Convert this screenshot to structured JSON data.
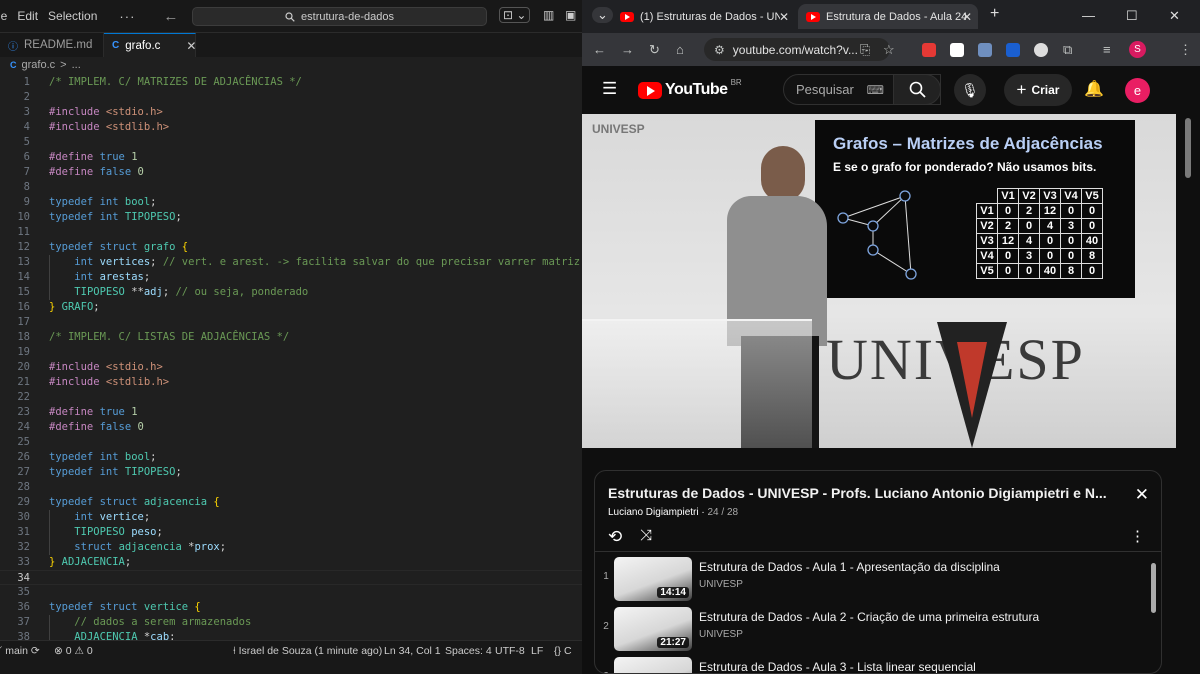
{
  "vscode": {
    "menu": [
      "le",
      "Edit",
      "Selection",
      "···"
    ],
    "search": "estrutura-de-dados",
    "tabs": [
      {
        "label": "README.md",
        "icon": "info-icon",
        "active": false
      },
      {
        "label": "grafo.c",
        "icon": "c-file-icon",
        "active": true
      }
    ],
    "breadcrumb": [
      "grafo.c",
      ">",
      "..."
    ],
    "lines": [
      [
        [
          "c-com",
          "/* IMPLEM. C/ MATRIZES DE ADJACÊNCIAS */"
        ]
      ],
      [],
      [
        [
          "c-pp",
          "#include "
        ],
        [
          "c-inc",
          "<stdio.h>"
        ]
      ],
      [
        [
          "c-pp",
          "#include "
        ],
        [
          "c-inc",
          "<stdlib.h>"
        ]
      ],
      [],
      [
        [
          "c-pp",
          "#define "
        ],
        [
          "c-kw",
          "true "
        ],
        [
          "c-num",
          "1"
        ]
      ],
      [
        [
          "c-pp",
          "#define "
        ],
        [
          "c-kw",
          "false "
        ],
        [
          "c-num",
          "0"
        ]
      ],
      [],
      [
        [
          "c-kw",
          "typedef "
        ],
        [
          "c-kw",
          "int "
        ],
        [
          "c-ty",
          "bool"
        ],
        [
          "c-txt",
          ";"
        ]
      ],
      [
        [
          "c-kw",
          "typedef "
        ],
        [
          "c-kw",
          "int "
        ],
        [
          "c-ty",
          "TIPOPESO"
        ],
        [
          "c-txt",
          ";"
        ]
      ],
      [],
      [
        [
          "c-kw",
          "typedef "
        ],
        [
          "c-kw",
          "struct "
        ],
        [
          "c-ty",
          "grafo "
        ],
        [
          "c-br",
          "{"
        ]
      ],
      [
        [
          "c-txt",
          "    "
        ],
        [
          "c-kw",
          "int "
        ],
        [
          "c-id",
          "vertices"
        ],
        [
          "c-txt",
          "; "
        ],
        [
          "c-com",
          "// vert. e arest. -> facilita salvar do que precisar varrer matriz sempre"
        ]
      ],
      [
        [
          "c-txt",
          "    "
        ],
        [
          "c-kw",
          "int "
        ],
        [
          "c-id",
          "arestas"
        ],
        [
          "c-txt",
          ";"
        ]
      ],
      [
        [
          "c-txt",
          "    "
        ],
        [
          "c-ty",
          "TIPOPESO "
        ],
        [
          "c-txt",
          "**"
        ],
        [
          "c-id",
          "adj"
        ],
        [
          "c-txt",
          "; "
        ],
        [
          "c-com",
          "// ou seja, ponderado"
        ]
      ],
      [
        [
          "c-br",
          "} "
        ],
        [
          "c-ty",
          "GRAFO"
        ],
        [
          "c-txt",
          ";"
        ]
      ],
      [],
      [
        [
          "c-com",
          "/* IMPLEM. C/ LISTAS DE ADJACÊNCIAS */"
        ]
      ],
      [],
      [
        [
          "c-pp",
          "#include "
        ],
        [
          "c-inc",
          "<stdio.h>"
        ]
      ],
      [
        [
          "c-pp",
          "#include "
        ],
        [
          "c-inc",
          "<stdlib.h>"
        ]
      ],
      [],
      [
        [
          "c-pp",
          "#define "
        ],
        [
          "c-kw",
          "true "
        ],
        [
          "c-num",
          "1"
        ]
      ],
      [
        [
          "c-pp",
          "#define "
        ],
        [
          "c-kw",
          "false "
        ],
        [
          "c-num",
          "0"
        ]
      ],
      [],
      [
        [
          "c-kw",
          "typedef "
        ],
        [
          "c-kw",
          "int "
        ],
        [
          "c-ty",
          "bool"
        ],
        [
          "c-txt",
          ";"
        ]
      ],
      [
        [
          "c-kw",
          "typedef "
        ],
        [
          "c-kw",
          "int "
        ],
        [
          "c-ty",
          "TIPOPESO"
        ],
        [
          "c-txt",
          ";"
        ]
      ],
      [],
      [
        [
          "c-kw",
          "typedef "
        ],
        [
          "c-kw",
          "struct "
        ],
        [
          "c-ty",
          "adjacencia "
        ],
        [
          "c-br",
          "{"
        ]
      ],
      [
        [
          "c-txt",
          "    "
        ],
        [
          "c-kw",
          "int "
        ],
        [
          "c-id",
          "vertice"
        ],
        [
          "c-txt",
          ";"
        ]
      ],
      [
        [
          "c-txt",
          "    "
        ],
        [
          "c-ty",
          "TIPOPESO "
        ],
        [
          "c-id",
          "peso"
        ],
        [
          "c-txt",
          ";"
        ]
      ],
      [
        [
          "c-txt",
          "    "
        ],
        [
          "c-kw",
          "struct "
        ],
        [
          "c-ty",
          "adjacencia "
        ],
        [
          "c-txt",
          "*"
        ],
        [
          "c-id",
          "prox"
        ],
        [
          "c-txt",
          ";"
        ]
      ],
      [
        [
          "c-br",
          "} "
        ],
        [
          "c-ty",
          "ADJACENCIA"
        ],
        [
          "c-txt",
          ";"
        ]
      ],
      [],
      [],
      [
        [
          "c-kw",
          "typedef "
        ],
        [
          "c-kw",
          "struct "
        ],
        [
          "c-ty",
          "vertice "
        ],
        [
          "c-br",
          "{"
        ]
      ],
      [
        [
          "c-txt",
          "    "
        ],
        [
          "c-com",
          "// dados a serem armazenados"
        ]
      ],
      [
        [
          "c-txt",
          "    "
        ],
        [
          "c-ty",
          "ADJACENCIA "
        ],
        [
          "c-txt",
          "*"
        ],
        [
          "c-id",
          "cab"
        ],
        [
          "c-txt",
          ";"
        ]
      ]
    ],
    "status": {
      "branch": "main",
      "problems": "0",
      "warnings": "0",
      "blame": "Israel de Souza (1 minute ago)",
      "position": "Ln 34, Col 1",
      "spaces": "Spaces: 4",
      "encoding": "UTF-8",
      "eol": "LF",
      "language": "C"
    }
  },
  "chrome": {
    "tabs": [
      {
        "label": "(1) Estruturas de Dados - UNIVE",
        "active": false
      },
      {
        "label": "Estrutura de Dados - Aula 24 - U",
        "active": true
      }
    ],
    "url": "youtube.com/watch?v...",
    "profile_initial": "S"
  },
  "youtube": {
    "logo": "YouTube",
    "region": "BR",
    "search_placeholder": "Pesquisar",
    "create_label": "Criar",
    "avatar_initial": "e",
    "video": {
      "brand": "UNIVESP",
      "slide_title": "Grafos – Matrizes de Adjacências",
      "slide_subtitle": "E se o grafo for ponderado? Não usamos bits.",
      "matrix_headers": [
        "",
        "V1",
        "V2",
        "V3",
        "V4",
        "V5"
      ],
      "matrix_rows": [
        [
          "V1",
          "0",
          "2",
          "12",
          "0",
          "0"
        ],
        [
          "V2",
          "2",
          "0",
          "4",
          "3",
          "0"
        ],
        [
          "V3",
          "12",
          "4",
          "0",
          "0",
          "40"
        ],
        [
          "V4",
          "0",
          "3",
          "0",
          "0",
          "8"
        ],
        [
          "V5",
          "0",
          "0",
          "40",
          "8",
          "0"
        ]
      ],
      "wall_text": "UNIVESP"
    },
    "playlist": {
      "title": "Estruturas de Dados - UNIVESP - Profs. Luciano Antonio Digiampietri e N...",
      "owner": "Luciano Digiampietri",
      "position": "24 / 28",
      "items": [
        {
          "index": "1",
          "title": "Estrutura de Dados - Aula 1 - Apresentação da disciplina",
          "channel": "UNIVESP",
          "duration": "14:14"
        },
        {
          "index": "2",
          "title": "Estrutura de Dados - Aula 2 - Criação de uma primeira estrutura",
          "channel": "UNIVESP",
          "duration": "21:27"
        },
        {
          "index": "3",
          "title": "Estrutura de Dados - Aula 3 - Lista linear sequencial",
          "channel": "UNIVESP",
          "duration": ""
        }
      ]
    }
  },
  "colors": {
    "vscode_bg": "#1f1f1f",
    "youtube_red": "#ff0000",
    "accent_blue": "#0078d4",
    "avatar_pink": "#e91e63"
  }
}
